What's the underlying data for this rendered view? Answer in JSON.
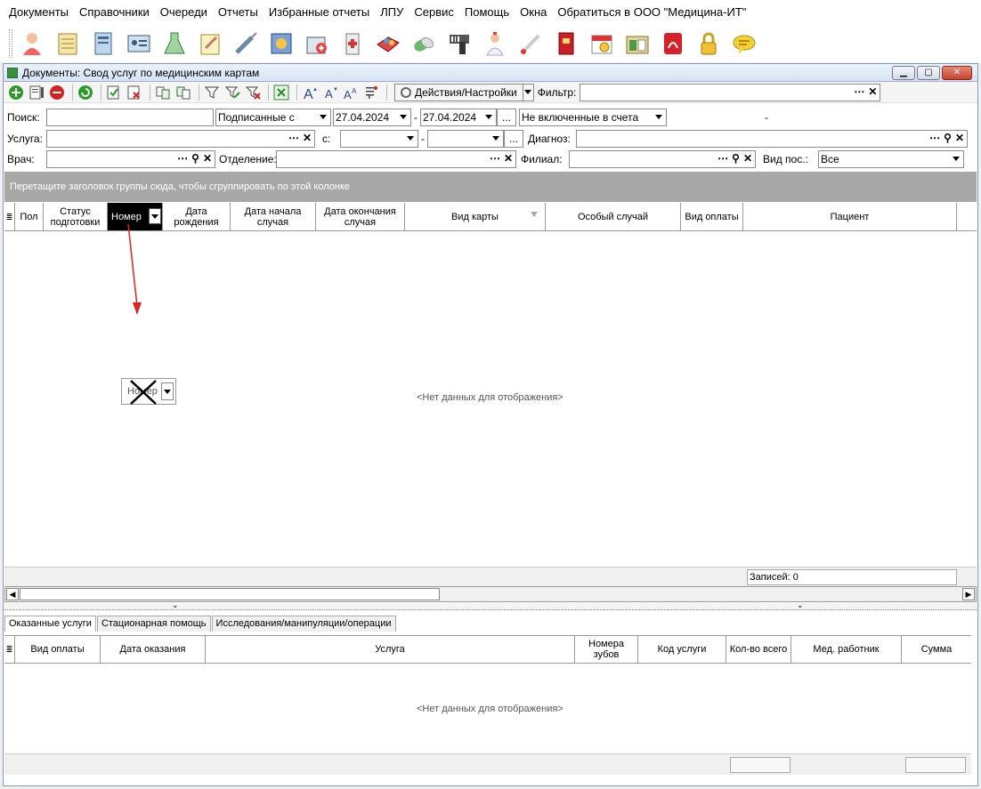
{
  "menu": [
    "Документы",
    "Справочники",
    "Очереди",
    "Отчеты",
    "Избранные отчеты",
    "ЛПУ",
    "Сервис",
    "Помощь",
    "Окна",
    "Обратиться в ООО \"Медицина-ИТ\""
  ],
  "toolbar_icons": [
    "doctor-icon",
    "journal-icon",
    "card-icon",
    "id-card-icon",
    "lab-flask-icon",
    "notepad-icon",
    "syringe-icon",
    "schedule-icon",
    "pharmacy-icon",
    "medical-kit-icon",
    "pills-box-icon",
    "capsules-icon",
    "barcode-scanner-icon",
    "nurse-icon",
    "thermometer-icon",
    "red-book-icon",
    "calendar-icon",
    "documents-folder-icon",
    "pdf-icon",
    "lock-icon",
    "chat-bubble-icon"
  ],
  "window": {
    "title": "Документы: Свод услуг по медицинским картам"
  },
  "row_toolbar": {
    "actions_label": "Действия/Настройки",
    "filter_label": "Фильтр:",
    "filter_value": ""
  },
  "filters": {
    "search_label": "Поиск:",
    "search_value": "",
    "signed_mode": "Подписанные с",
    "date_from": "27.04.2024",
    "date_dash": "-",
    "date_to": "27.04.2024",
    "dots": "...",
    "invoice_mode": "Не включенные в счета",
    "small_dash": "-",
    "service_label": "Услуга:",
    "with_label": "с:",
    "diagnosis_label": "Диагноз:",
    "doctor_label": "Врач:",
    "department_label": "Отделение:",
    "branch_label": "Филиал:",
    "visit_type_label": "Вид пос.:",
    "visit_type_value": "Все"
  },
  "group_panel_text": "Перетащите заголовок группы сюда, чтобы сгруппировать по этой колонке",
  "grid_columns": [
    "Пол",
    "Статус подготовки",
    "Номер",
    "Дата рождения",
    "Дата начала случая",
    "Дата окончания случая",
    "Вид карты",
    "Особый случай",
    "Вид оплаты",
    "Пациент"
  ],
  "no_data": "<Нет данных для отображения>",
  "records_label": "Записей: 0",
  "drag_ghost_label": "Номер",
  "tabs": [
    "Оказанные услуги",
    "Стационарная помощь",
    "Исследования/манипуляции/операции"
  ],
  "services_columns": [
    "Вид оплаты",
    "Дата оказания",
    "Услуга",
    "Номера зубов",
    "Код услуги",
    "Кол-во всего",
    "Мед. работник",
    "Сумма"
  ],
  "no_data_2": "<Нет данных для отображения>"
}
